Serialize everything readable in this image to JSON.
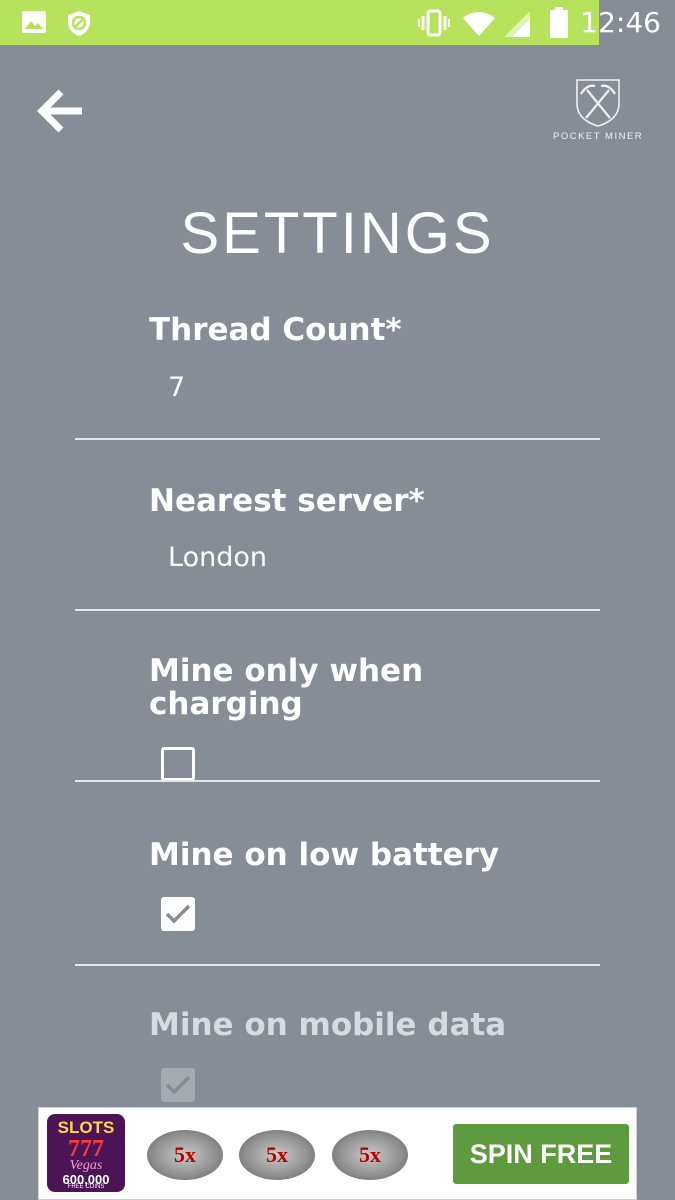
{
  "status_bar": {
    "time": "12:46",
    "left_icons": [
      "image-icon",
      "data-saver-icon"
    ],
    "right_icons": [
      "vibrate-icon",
      "wifi-icon",
      "signal-icon",
      "battery-icon"
    ],
    "color": "#b6e25c"
  },
  "header": {
    "back_icon": "arrow-left-icon",
    "logo_text": "POCKET MINER"
  },
  "page_title": "SETTINGS",
  "settings": {
    "thread_count": {
      "label": "Thread Count*",
      "value": "7"
    },
    "nearest_server": {
      "label": "Nearest server*",
      "value": "London"
    },
    "mine_only_charging": {
      "label_line1": "Mine only when",
      "label_line2": "charging",
      "checked": false
    },
    "mine_low_battery": {
      "label": "Mine on low battery",
      "checked": true
    },
    "mine_mobile_data": {
      "label": "Mine on mobile data",
      "checked": true,
      "disabled": true
    }
  },
  "ad": {
    "logo_line1": "SLOTS",
    "logo_line2": "777",
    "logo_line3": "Vegas",
    "logo_line4": "600,000",
    "logo_line5": "FREE COINS",
    "reels": [
      "5x",
      "5x",
      "5x"
    ],
    "cta": "SPIN FREE",
    "cta_color": "#5e9a3e"
  },
  "colors": {
    "background": "#878d96",
    "divider": "#e4e6e9"
  }
}
